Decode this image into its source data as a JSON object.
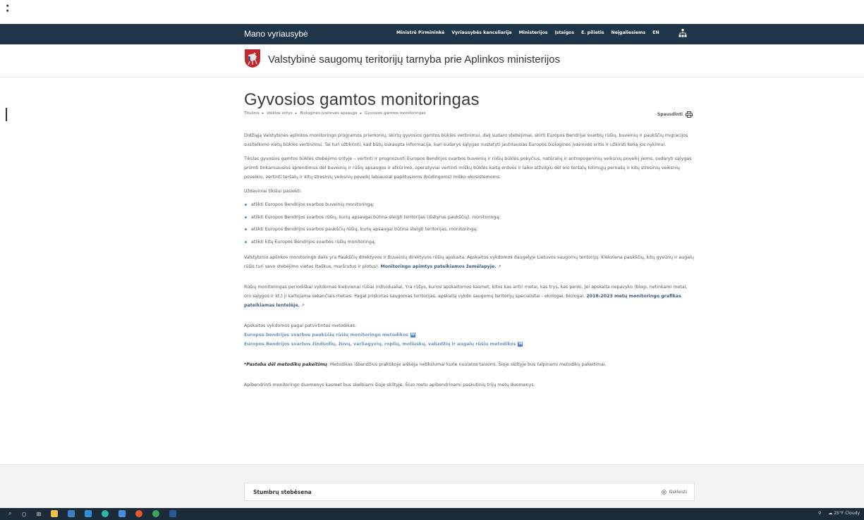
{
  "nav": {
    "brand": "Mano vyriausybė",
    "links": [
      "Ministrė Pirmininkė",
      "Vyriausybės kanceliarija",
      "Ministerijos",
      "Įstaigos",
      "E. pilietis",
      "Neįgaliesiems",
      "EN"
    ]
  },
  "header": {
    "site_title": "Valstybinė saugomų teritorijų tarnyba prie Aplinkos ministerijos"
  },
  "page": {
    "title": "Gyvosios gamtos monitoringas",
    "breadcrumb": [
      "Titulinis",
      "Veiklos sritys",
      "Biologinės įvairovės apsauga",
      "Gyvosios gamtos monitoringas"
    ],
    "print_label": "Spausdinti"
  },
  "content": {
    "p1": "Didžiąją Valstybinės aplinkos monitoringo programos priemonių, skirtų gyvosios gamtos būklės vertinimui, dalį sudaro stebėjimai, skirti Europos Bendrijai svarbių rūšių, buveinių ir paukščių migracijos susitelkimo vietų būklės vertinimui. Tai turi užtikrinti, kad būtų sukaupta informacija, kuri sudarys sąlygas nustatyti jautriausias Europos biologinės įvairovės sritis ir užkirsti kelią jos nykimui.",
    "p2": "Tikslas gyvosios gamtos būklės stebėjimo srityje – vertinti ir prognozuoti Europos Bendrijos svarbos buveinių ir rūšių būklės pokyčius, natūralių ir antropogeninių veiksnių poveikį jiems, sudaryti sąlygas priimti tinkamiausius sprendimus dėl buveinių ir rūšių apsaugos ir atkūrimo, operatyviai vertinti miškų būklės kaitą erdvės ir laiko atžvilgiu dėl oro teršalų tolimųjų pernašų ir kitų stresinių veiksnių poveikio, vertinti teršalų ir kitų stresinių veiksnių poveikį labiausiai paplitusioms (būdingoms) miško ekosistemoms.",
    "p3": "Uždaviniai tikslui pasiekti:",
    "bullets": [
      "atlikti Europos Bendrijos svarbos buveinių monitoringą;",
      "atlikti Europos Bendrijos svarbos rūšių, kurių apsaugai būtina steigti teritorijas (išskyrus paukščių), monitoringą;",
      "atlikti Europos Bendrijos svarbos paukščių rūšių, kurių apsaugai būtina steigti teritorijas, monitoringą;",
      "atlikti kitų Europos Bendrijos svarbos rūšių monitoringą;"
    ],
    "p4": "Valstybinio aplinkos monitoringo dalis yra Paukščių direktyvos ir Buveinių direktyvos rūšių apskaita. Apskaitos vykdomos daugelyje Lietuvos saugomų teritorijų. Kiekviena paukščių, kitų gyvūnų ir augalų rūšis turi savo stebėjimo vietas (taškus, maršrutus ir plotus).",
    "p4_link": "Monitoringo apimtys pateikiamos žemėlapyje.",
    "p5": "Rūšių monitoringas periodiškai vykdomas kiekvienai rūšiai individualiai. Yra rūšys, kurios apskaitomos kasmet, kitos kas antri metai, kas trys, kas penki. Jei apskaita nepavyko (blogi, netinkami metai, oro sąlygos ir kt.) ji kartojama sekančiais metais. Pagal priskirtas saugomas teritorijas, apskaitą vykdo saugomų teritorijų specialistai - ekologai, biologai.",
    "p5_link": "2018-2023 metų monitoringo grafikas pateikiamas lentelėje.",
    "p6": "Apskaitos vykdomos pagal patvirtintas metodikas:",
    "methods": [
      "Europos bendrijos svarbos paukščių rūšių monitoringo metodikos",
      "Europos Bendrijos svarbos žinduolių, žuvų, varliagyvių, roplių, moliuskų, vabzdžių ir augalų rūšių metodikos"
    ],
    "note_label": "*Pastaba dėl metodikų pakeitimų",
    "note_text": ". Metodikas išbandžius praktikoje aiškėja netikslumai kurie nuolatos taisomi. Šioje skiltyje bus talpinami metodikų pakeitimai.",
    "p7": "Apibendrinti monitoringo duomenys kasmet bus skelbiami šioje skiltyje. Šiuo metu apibendrinami paskutinių trijų metų duomenys."
  },
  "accordion": {
    "title": "Stumbrų stebėsena",
    "toggle": "Išskleisti"
  },
  "taskbar": {
    "weather": "25°F Cloudy"
  }
}
